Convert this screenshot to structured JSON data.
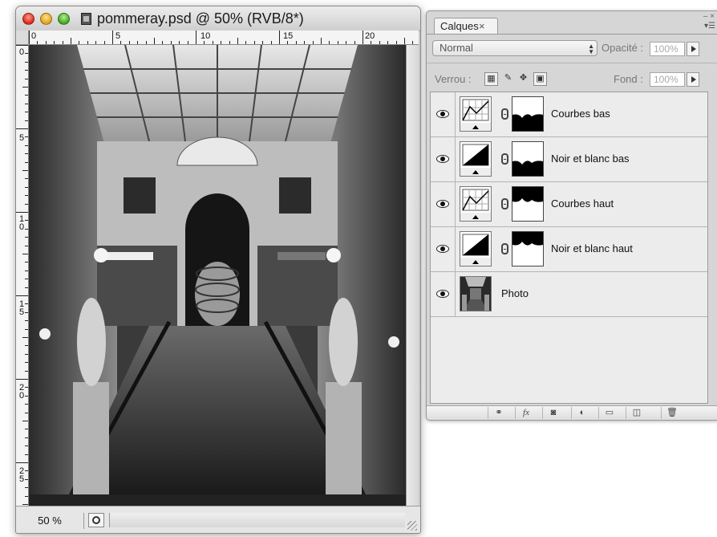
{
  "document_window": {
    "title": "pommeray.psd @ 50% (RVB/8*)",
    "ruler_top_labels": [
      "0",
      "5",
      "10",
      "15",
      "20"
    ],
    "ruler_left_labels": [
      "0",
      "5",
      "10",
      "15",
      "20",
      "25"
    ],
    "zoom": "50 %"
  },
  "layers_panel": {
    "tab_label": "Calques",
    "tab_close": "×",
    "blend_mode": "Normal",
    "opacity_label": "Opacité :",
    "opacity_value": "100%",
    "lock_label": "Verrou :",
    "fill_label": "Fond :",
    "fill_value": "100%",
    "layers": [
      {
        "name": "Courbes bas",
        "thumb": "curves-icon"
      },
      {
        "name": "Noir et blanc bas",
        "thumb": "black-white-icon"
      },
      {
        "name": "Courbes haut",
        "thumb": "curves-icon"
      },
      {
        "name": "Noir et blanc haut",
        "thumb": "black-white-icon"
      },
      {
        "name": "Photo",
        "thumb": "photo-thumbnail"
      }
    ],
    "footer_fx": "fx"
  }
}
